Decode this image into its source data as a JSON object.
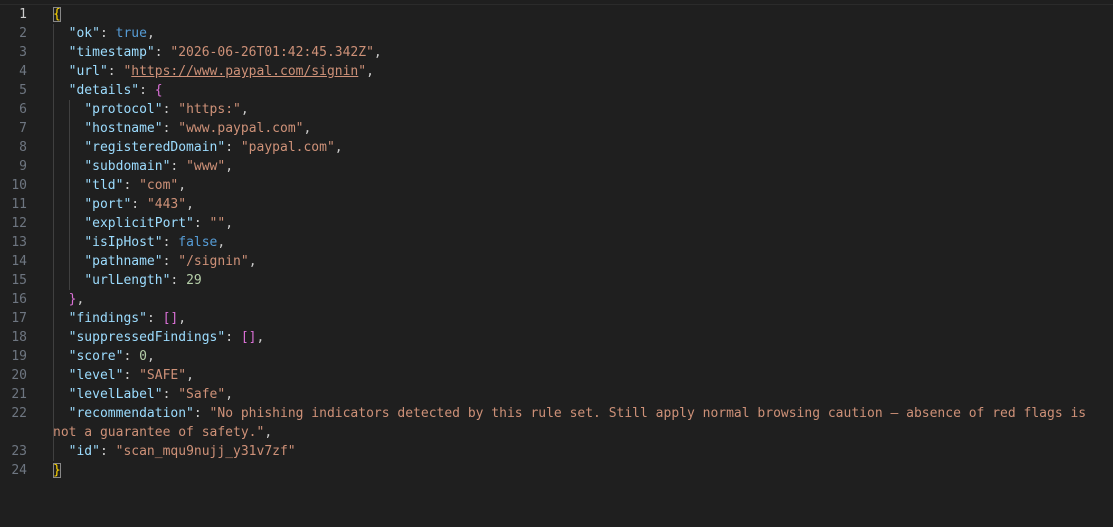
{
  "editor": {
    "lines": [
      {
        "n": "1",
        "tokens": [
          {
            "t": "{",
            "c": "br1 bracket-match"
          }
        ]
      },
      {
        "n": "2",
        "tokens": [
          {
            "t": "  ",
            "c": "p"
          },
          {
            "t": "\"ok\"",
            "c": "k"
          },
          {
            "t": ": ",
            "c": "p"
          },
          {
            "t": "true",
            "c": "b"
          },
          {
            "t": ",",
            "c": "p"
          }
        ]
      },
      {
        "n": "3",
        "tokens": [
          {
            "t": "  ",
            "c": "p"
          },
          {
            "t": "\"timestamp\"",
            "c": "k"
          },
          {
            "t": ": ",
            "c": "p"
          },
          {
            "t": "\"2026-06-26T01:42:45.342Z\"",
            "c": "s"
          },
          {
            "t": ",",
            "c": "p"
          }
        ]
      },
      {
        "n": "4",
        "tokens": [
          {
            "t": "  ",
            "c": "p"
          },
          {
            "t": "\"url\"",
            "c": "k"
          },
          {
            "t": ": ",
            "c": "p"
          },
          {
            "t": "\"",
            "c": "s"
          },
          {
            "t": "https://www.paypal.com/signin",
            "c": "url"
          },
          {
            "t": "\"",
            "c": "s"
          },
          {
            "t": ",",
            "c": "p"
          }
        ]
      },
      {
        "n": "5",
        "tokens": [
          {
            "t": "  ",
            "c": "p"
          },
          {
            "t": "\"details\"",
            "c": "k"
          },
          {
            "t": ": ",
            "c": "p"
          },
          {
            "t": "{",
            "c": "br2"
          }
        ]
      },
      {
        "n": "6",
        "tokens": [
          {
            "t": "    ",
            "c": "p"
          },
          {
            "t": "\"protocol\"",
            "c": "k"
          },
          {
            "t": ": ",
            "c": "p"
          },
          {
            "t": "\"https:\"",
            "c": "s"
          },
          {
            "t": ",",
            "c": "p"
          }
        ]
      },
      {
        "n": "7",
        "tokens": [
          {
            "t": "    ",
            "c": "p"
          },
          {
            "t": "\"hostname\"",
            "c": "k"
          },
          {
            "t": ": ",
            "c": "p"
          },
          {
            "t": "\"www.paypal.com\"",
            "c": "s"
          },
          {
            "t": ",",
            "c": "p"
          }
        ]
      },
      {
        "n": "8",
        "tokens": [
          {
            "t": "    ",
            "c": "p"
          },
          {
            "t": "\"registeredDomain\"",
            "c": "k"
          },
          {
            "t": ": ",
            "c": "p"
          },
          {
            "t": "\"paypal.com\"",
            "c": "s"
          },
          {
            "t": ",",
            "c": "p"
          }
        ]
      },
      {
        "n": "9",
        "tokens": [
          {
            "t": "    ",
            "c": "p"
          },
          {
            "t": "\"subdomain\"",
            "c": "k"
          },
          {
            "t": ": ",
            "c": "p"
          },
          {
            "t": "\"www\"",
            "c": "s"
          },
          {
            "t": ",",
            "c": "p"
          }
        ]
      },
      {
        "n": "10",
        "tokens": [
          {
            "t": "    ",
            "c": "p"
          },
          {
            "t": "\"tld\"",
            "c": "k"
          },
          {
            "t": ": ",
            "c": "p"
          },
          {
            "t": "\"com\"",
            "c": "s"
          },
          {
            "t": ",",
            "c": "p"
          }
        ]
      },
      {
        "n": "11",
        "tokens": [
          {
            "t": "    ",
            "c": "p"
          },
          {
            "t": "\"port\"",
            "c": "k"
          },
          {
            "t": ": ",
            "c": "p"
          },
          {
            "t": "\"443\"",
            "c": "s"
          },
          {
            "t": ",",
            "c": "p"
          }
        ]
      },
      {
        "n": "12",
        "tokens": [
          {
            "t": "    ",
            "c": "p"
          },
          {
            "t": "\"explicitPort\"",
            "c": "k"
          },
          {
            "t": ": ",
            "c": "p"
          },
          {
            "t": "\"\"",
            "c": "s"
          },
          {
            "t": ",",
            "c": "p"
          }
        ]
      },
      {
        "n": "13",
        "tokens": [
          {
            "t": "    ",
            "c": "p"
          },
          {
            "t": "\"isIpHost\"",
            "c": "k"
          },
          {
            "t": ": ",
            "c": "p"
          },
          {
            "t": "false",
            "c": "b"
          },
          {
            "t": ",",
            "c": "p"
          }
        ]
      },
      {
        "n": "14",
        "tokens": [
          {
            "t": "    ",
            "c": "p"
          },
          {
            "t": "\"pathname\"",
            "c": "k"
          },
          {
            "t": ": ",
            "c": "p"
          },
          {
            "t": "\"/signin\"",
            "c": "s"
          },
          {
            "t": ",",
            "c": "p"
          }
        ]
      },
      {
        "n": "15",
        "tokens": [
          {
            "t": "    ",
            "c": "p"
          },
          {
            "t": "\"urlLength\"",
            "c": "k"
          },
          {
            "t": ": ",
            "c": "p"
          },
          {
            "t": "29",
            "c": "n"
          }
        ]
      },
      {
        "n": "16",
        "tokens": [
          {
            "t": "  ",
            "c": "p"
          },
          {
            "t": "}",
            "c": "br2"
          },
          {
            "t": ",",
            "c": "p"
          }
        ]
      },
      {
        "n": "17",
        "tokens": [
          {
            "t": "  ",
            "c": "p"
          },
          {
            "t": "\"findings\"",
            "c": "k"
          },
          {
            "t": ": ",
            "c": "p"
          },
          {
            "t": "[]",
            "c": "br2"
          },
          {
            "t": ",",
            "c": "p"
          }
        ]
      },
      {
        "n": "18",
        "tokens": [
          {
            "t": "  ",
            "c": "p"
          },
          {
            "t": "\"suppressedFindings\"",
            "c": "k"
          },
          {
            "t": ": ",
            "c": "p"
          },
          {
            "t": "[]",
            "c": "br2"
          },
          {
            "t": ",",
            "c": "p"
          }
        ]
      },
      {
        "n": "19",
        "tokens": [
          {
            "t": "  ",
            "c": "p"
          },
          {
            "t": "\"score\"",
            "c": "k"
          },
          {
            "t": ": ",
            "c": "p"
          },
          {
            "t": "0",
            "c": "n"
          },
          {
            "t": ",",
            "c": "p"
          }
        ]
      },
      {
        "n": "20",
        "tokens": [
          {
            "t": "  ",
            "c": "p"
          },
          {
            "t": "\"level\"",
            "c": "k"
          },
          {
            "t": ": ",
            "c": "p"
          },
          {
            "t": "\"SAFE\"",
            "c": "s"
          },
          {
            "t": ",",
            "c": "p"
          }
        ]
      },
      {
        "n": "21",
        "tokens": [
          {
            "t": "  ",
            "c": "p"
          },
          {
            "t": "\"levelLabel\"",
            "c": "k"
          },
          {
            "t": ": ",
            "c": "p"
          },
          {
            "t": "\"Safe\"",
            "c": "s"
          },
          {
            "t": ",",
            "c": "p"
          }
        ]
      },
      {
        "n": "22",
        "wrapped": true,
        "tokens": [
          {
            "t": "  ",
            "c": "p"
          },
          {
            "t": "\"recommendation\"",
            "c": "k"
          },
          {
            "t": ": ",
            "c": "p"
          },
          {
            "t": "\"No phishing indicators detected by this rule set. Still apply normal browsing caution — absence of red flags is not a guarantee of safety.\"",
            "c": "s"
          },
          {
            "t": ",",
            "c": "p"
          }
        ]
      },
      {
        "n": "23",
        "tokens": [
          {
            "t": "  ",
            "c": "p"
          },
          {
            "t": "\"id\"",
            "c": "k"
          },
          {
            "t": ": ",
            "c": "p"
          },
          {
            "t": "\"scan_mqu9nujj_y31v7zf\"",
            "c": "s"
          }
        ]
      },
      {
        "n": "24",
        "tokens": [
          {
            "t": "}",
            "c": "br1 bracket-match"
          }
        ]
      }
    ]
  },
  "colors": {
    "background": "#1f1f1f",
    "key": "#9cdcfe",
    "string": "#ce9178",
    "number": "#b5cea8",
    "boolean": "#569cd6",
    "bracket_outer": "#ffd700",
    "bracket_inner": "#da70d6"
  }
}
